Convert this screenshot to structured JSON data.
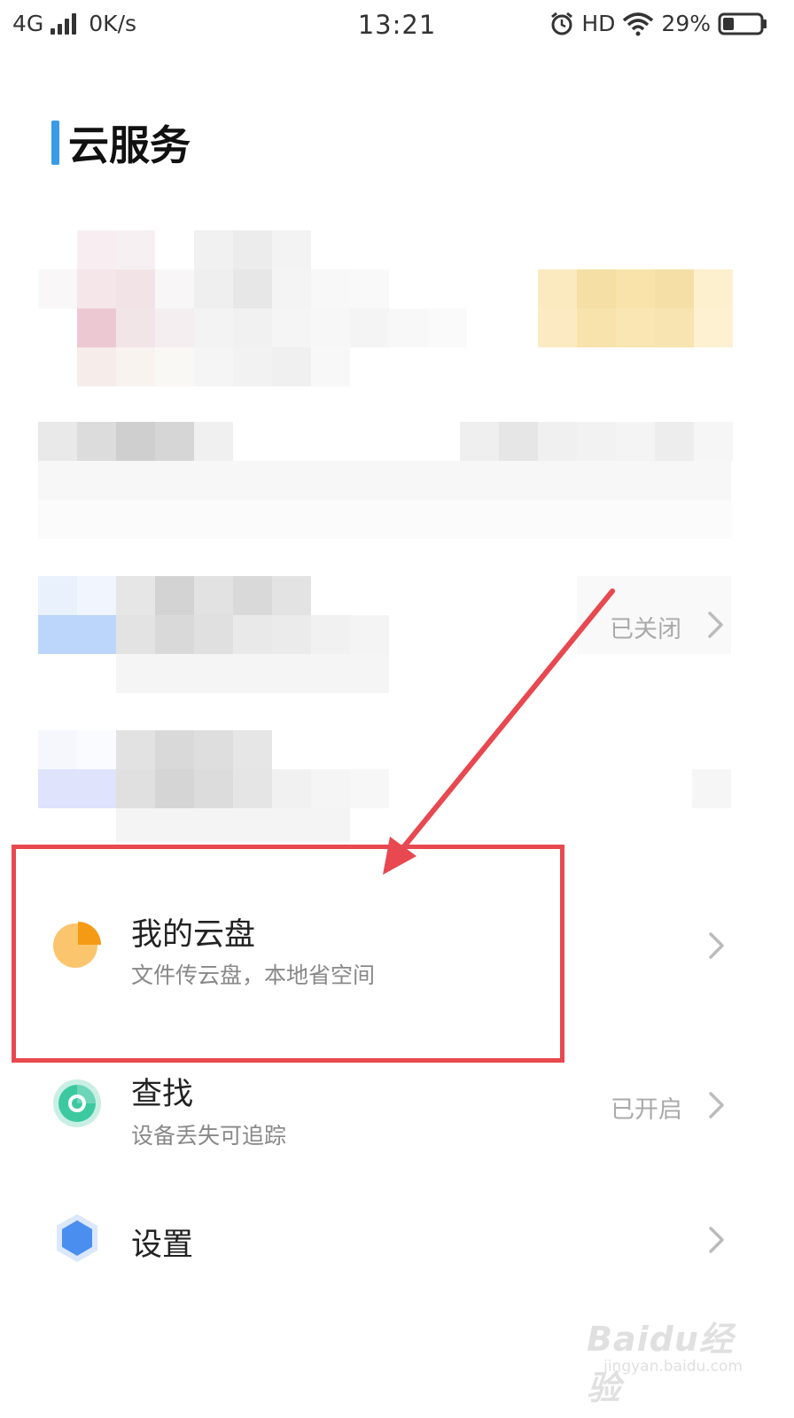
{
  "status_bar": {
    "network": "4G",
    "speed": "0K/s",
    "time": "13:21",
    "hd": "HD",
    "battery": "29%",
    "battery_level": 0.29
  },
  "page_title": "云服务",
  "obscured_row": {
    "status": "已关闭"
  },
  "items": [
    {
      "title": "我的云盘",
      "subtitle": "文件传云盘，本地省空间",
      "icon": "cloud-disk-pie-icon",
      "status": ""
    },
    {
      "title": "查找",
      "subtitle": "设备丢失可追踪",
      "icon": "find-radar-icon",
      "status": "已开启"
    },
    {
      "title": "设置",
      "subtitle": "",
      "icon": "settings-hexagon-icon",
      "status": ""
    }
  ],
  "annotation": {
    "color": "#e8484f"
  },
  "watermark": {
    "line1": "Baidu经验",
    "line2": "jingyan.baidu.com"
  },
  "colors": {
    "accent": "#3a9be8",
    "cloud_disk_orange": "#f5a623",
    "find_teal": "#3cc9a0",
    "settings_blue": "#4a8ef0"
  }
}
